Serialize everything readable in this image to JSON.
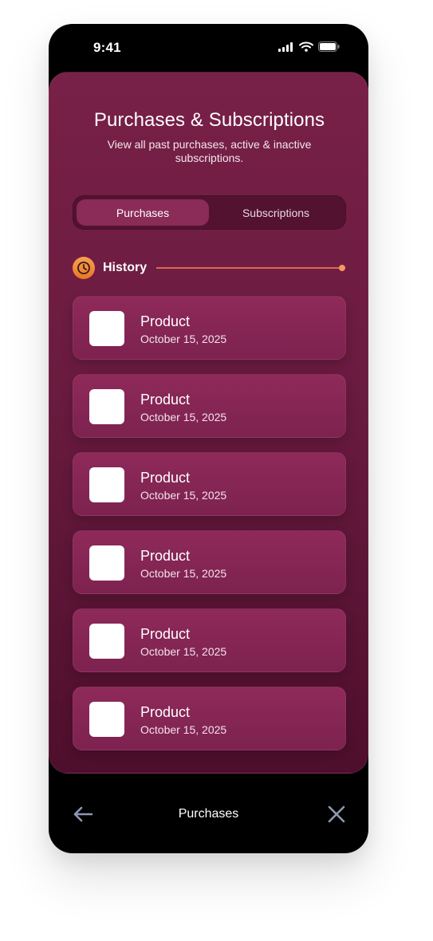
{
  "status_bar": {
    "time": "9:41"
  },
  "header": {
    "title": "Purchases & Subscriptions",
    "subtitle": "View all past purchases, active & inactive subscriptions."
  },
  "tabs": [
    {
      "label": "Purchases",
      "active": true
    },
    {
      "label": "Subscriptions",
      "active": false
    }
  ],
  "history": {
    "label": "History",
    "icon": "clock-icon"
  },
  "items": [
    {
      "title": "Product",
      "date": "October 15, 2025"
    },
    {
      "title": "Product",
      "date": "October 15, 2025"
    },
    {
      "title": "Product",
      "date": "October 15, 2025"
    },
    {
      "title": "Product",
      "date": "October 15, 2025"
    },
    {
      "title": "Product",
      "date": "October 15, 2025"
    },
    {
      "title": "Product",
      "date": "October 15, 2025"
    }
  ],
  "bottom_bar": {
    "title": "Purchases",
    "back_icon": "arrow-left-icon",
    "close_icon": "close-icon"
  },
  "colors": {
    "accent": "#f49a5e",
    "panel": "#6a1b40",
    "card": "#8a2b58"
  }
}
